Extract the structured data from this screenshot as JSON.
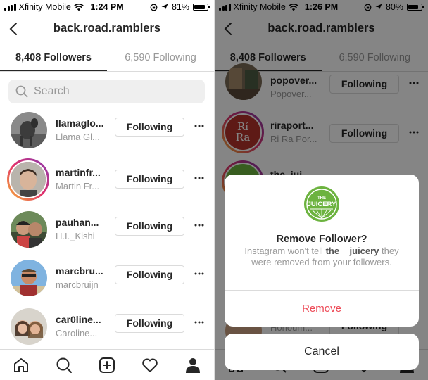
{
  "left": {
    "status": {
      "carrier": "Xfinity Mobile",
      "time": "1:24 PM",
      "battery": "81%",
      "battery_fraction": 0.81
    },
    "header": {
      "title": "back.road.ramblers"
    },
    "tabs": {
      "followers": "8,408 Followers",
      "following": "6,590 Following"
    },
    "search": {
      "placeholder": "Search"
    },
    "rows": [
      {
        "username": "llamaglo...",
        "fullname": "Llama Gl...",
        "button": "Following"
      },
      {
        "username": "martinfr...",
        "fullname": "Martin Fr...",
        "button": "Following"
      },
      {
        "username": "pauhan...",
        "fullname": "H.I._Kishi",
        "button": "Following"
      },
      {
        "username": "marcbru...",
        "fullname": "marcbruijn",
        "button": "Following"
      },
      {
        "username": "car0line...",
        "fullname": "Caroline...",
        "button": "Following"
      }
    ]
  },
  "right": {
    "status": {
      "carrier": "Xfinity Mobile",
      "time": "1:26 PM",
      "battery": "80%",
      "battery_fraction": 0.8
    },
    "header": {
      "title": "back.road.ramblers"
    },
    "tabs": {
      "followers": "8,408 Followers",
      "following": "6,590 Following"
    },
    "rows": [
      {
        "username": "popover...",
        "fullname": "Popover...",
        "button": "Following"
      },
      {
        "username": "riraport...",
        "fullname": "Ri Ra Por...",
        "button": "Following",
        "avatar_text": "Rí Ra"
      },
      {
        "username": "the_jui...",
        "fullname": "",
        "button": "Following"
      },
      {
        "username": "",
        "fullname": "Honoum...",
        "button": "Following"
      }
    ],
    "dialog": {
      "logo_text": "JUICERY",
      "logo_small": "THE",
      "title": "Remove Follower?",
      "text_before": "Instagram won't tell ",
      "text_user": "the__juicery",
      "text_after": " they were removed from your followers.",
      "remove": "Remove",
      "cancel": "Cancel"
    }
  },
  "colors": {
    "accent_red": "#ed4956",
    "juicery_green": "#6cb33f",
    "rira_red": "#b5322b"
  },
  "tabbar_icons": [
    "home-icon",
    "search-icon",
    "new-post-icon",
    "activity-heart-icon",
    "profile-icon"
  ]
}
